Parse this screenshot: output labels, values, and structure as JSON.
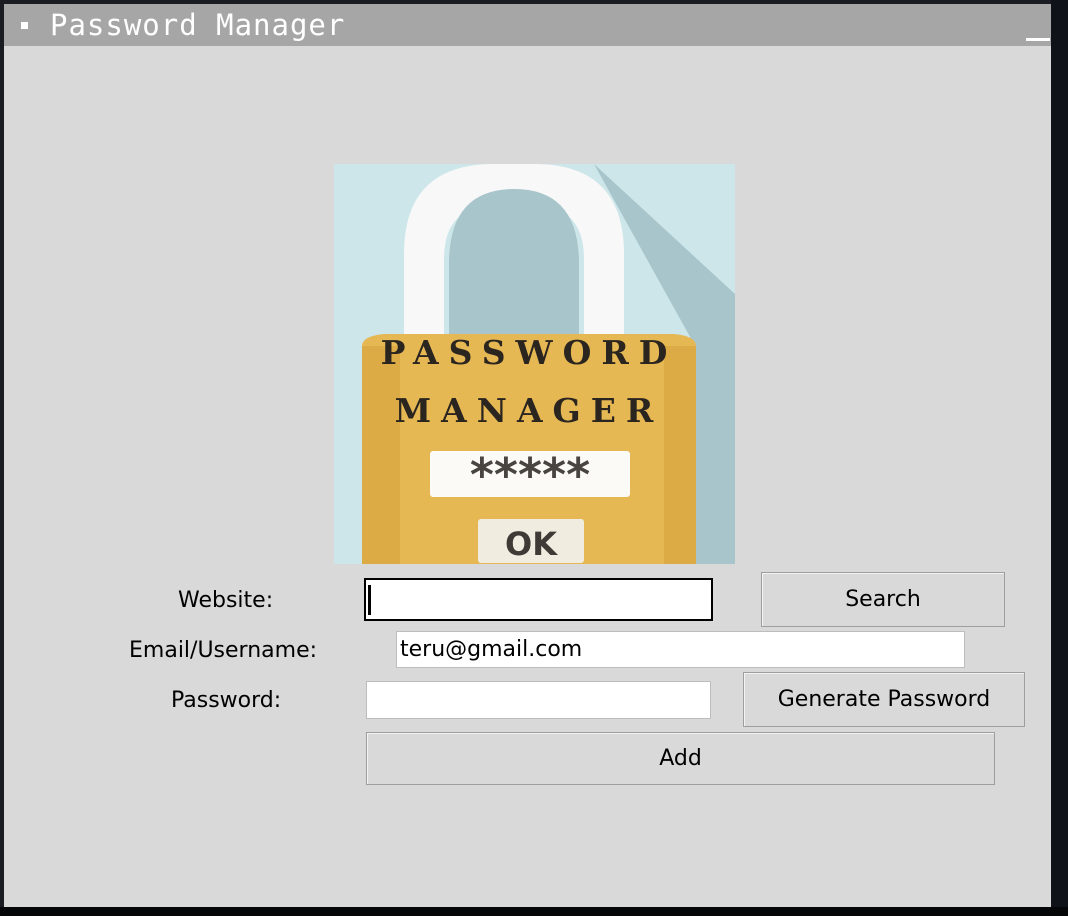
{
  "window": {
    "title": "Password Manager"
  },
  "logo": {
    "line1": "PASSWORD",
    "line2": "MANAGER",
    "mask": "*****",
    "ok": "OK",
    "colors": {
      "background": "#cde6ea",
      "shadow": "#a8c5cb",
      "shackle": "#f8f8f8",
      "body": "#e6b854",
      "body_shade": "#d9a93f"
    }
  },
  "form": {
    "website": {
      "label": "Website:",
      "value": ""
    },
    "search_button": "Search",
    "email": {
      "label": "Email/Username:",
      "value": "teru@gmail.com"
    },
    "password": {
      "label": "Password:",
      "value": ""
    },
    "generate_button": "Generate Password",
    "add_button": "Add"
  }
}
